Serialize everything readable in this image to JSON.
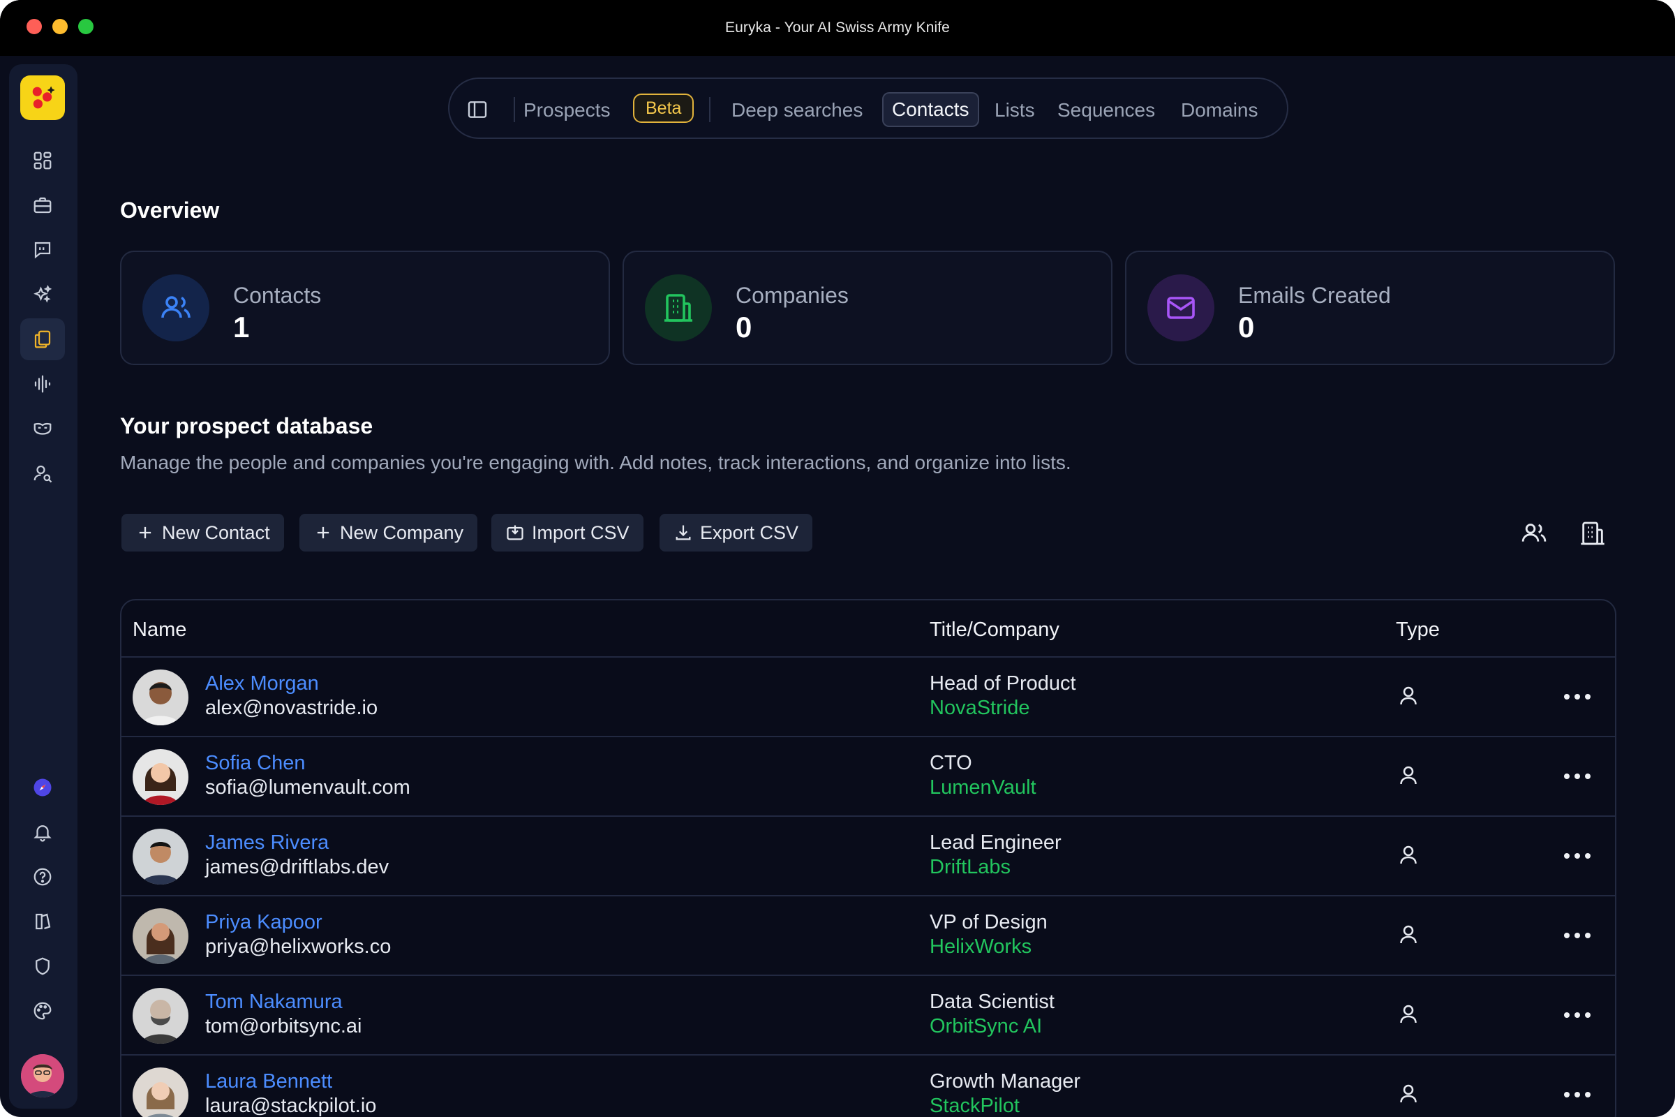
{
  "window": {
    "title": "Euryka - Your AI Swiss Army Knife"
  },
  "sidebar": {
    "items": [
      {
        "icon": "dashboard-icon"
      },
      {
        "icon": "briefcase-icon"
      },
      {
        "icon": "chat-icon"
      },
      {
        "icon": "sparkles-icon"
      },
      {
        "icon": "documents-icon",
        "active": true
      },
      {
        "icon": "waveform-icon"
      },
      {
        "icon": "mask-icon"
      },
      {
        "icon": "user-search-icon"
      }
    ],
    "bottom_items": [
      {
        "icon": "compass-icon"
      },
      {
        "icon": "bell-icon"
      },
      {
        "icon": "help-icon"
      },
      {
        "icon": "book-icon"
      },
      {
        "icon": "shield-icon"
      },
      {
        "icon": "palette-icon"
      }
    ]
  },
  "topnav": {
    "prospects": "Prospects",
    "beta": "Beta",
    "deep_searches": "Deep searches",
    "contacts": "Contacts",
    "lists": "Lists",
    "sequences": "Sequences",
    "domains": "Domains"
  },
  "overview": {
    "heading": "Overview",
    "cards": [
      {
        "label": "Contacts",
        "value": "1",
        "icon": "users-icon",
        "color": "#3b82f6"
      },
      {
        "label": "Companies",
        "value": "0",
        "icon": "building-icon",
        "color": "#22c55e"
      },
      {
        "label": "Emails Created",
        "value": "0",
        "icon": "mail-icon",
        "color": "#a855f7"
      }
    ]
  },
  "database": {
    "heading": "Your prospect database",
    "description": "Manage the people and companies you're engaging with. Add notes, track interactions, and organize into lists."
  },
  "actions": {
    "new_contact": "New Contact",
    "new_company": "New Company",
    "import_csv": "Import CSV",
    "export_csv": "Export CSV"
  },
  "table": {
    "headers": {
      "name": "Name",
      "title_company": "Title/Company",
      "type": "Type"
    },
    "rows": [
      {
        "name": "Alex Morgan",
        "email": "alex@novastride.io",
        "title": "Head of Product",
        "company": "NovaStride"
      },
      {
        "name": "Sofia Chen",
        "email": "sofia@lumenvault.com",
        "title": "CTO",
        "company": "LumenVault"
      },
      {
        "name": "James Rivera",
        "email": "james@driftlabs.dev",
        "title": "Lead Engineer",
        "company": "DriftLabs"
      },
      {
        "name": "Priya Kapoor",
        "email": "priya@helixworks.co",
        "title": "VP of Design",
        "company": "HelixWorks"
      },
      {
        "name": "Tom Nakamura",
        "email": "tom@orbitsync.ai",
        "title": "Data Scientist",
        "company": "OrbitSync AI"
      },
      {
        "name": "Laura Bennett",
        "email": "laura@stackpilot.io",
        "title": "Growth Manager",
        "company": "StackPilot"
      }
    ]
  },
  "colors": {
    "accent_blue": "#4c8dff",
    "company_green": "#22c55e",
    "beta_yellow": "#f5c84c",
    "background": "#0a0d1c"
  }
}
